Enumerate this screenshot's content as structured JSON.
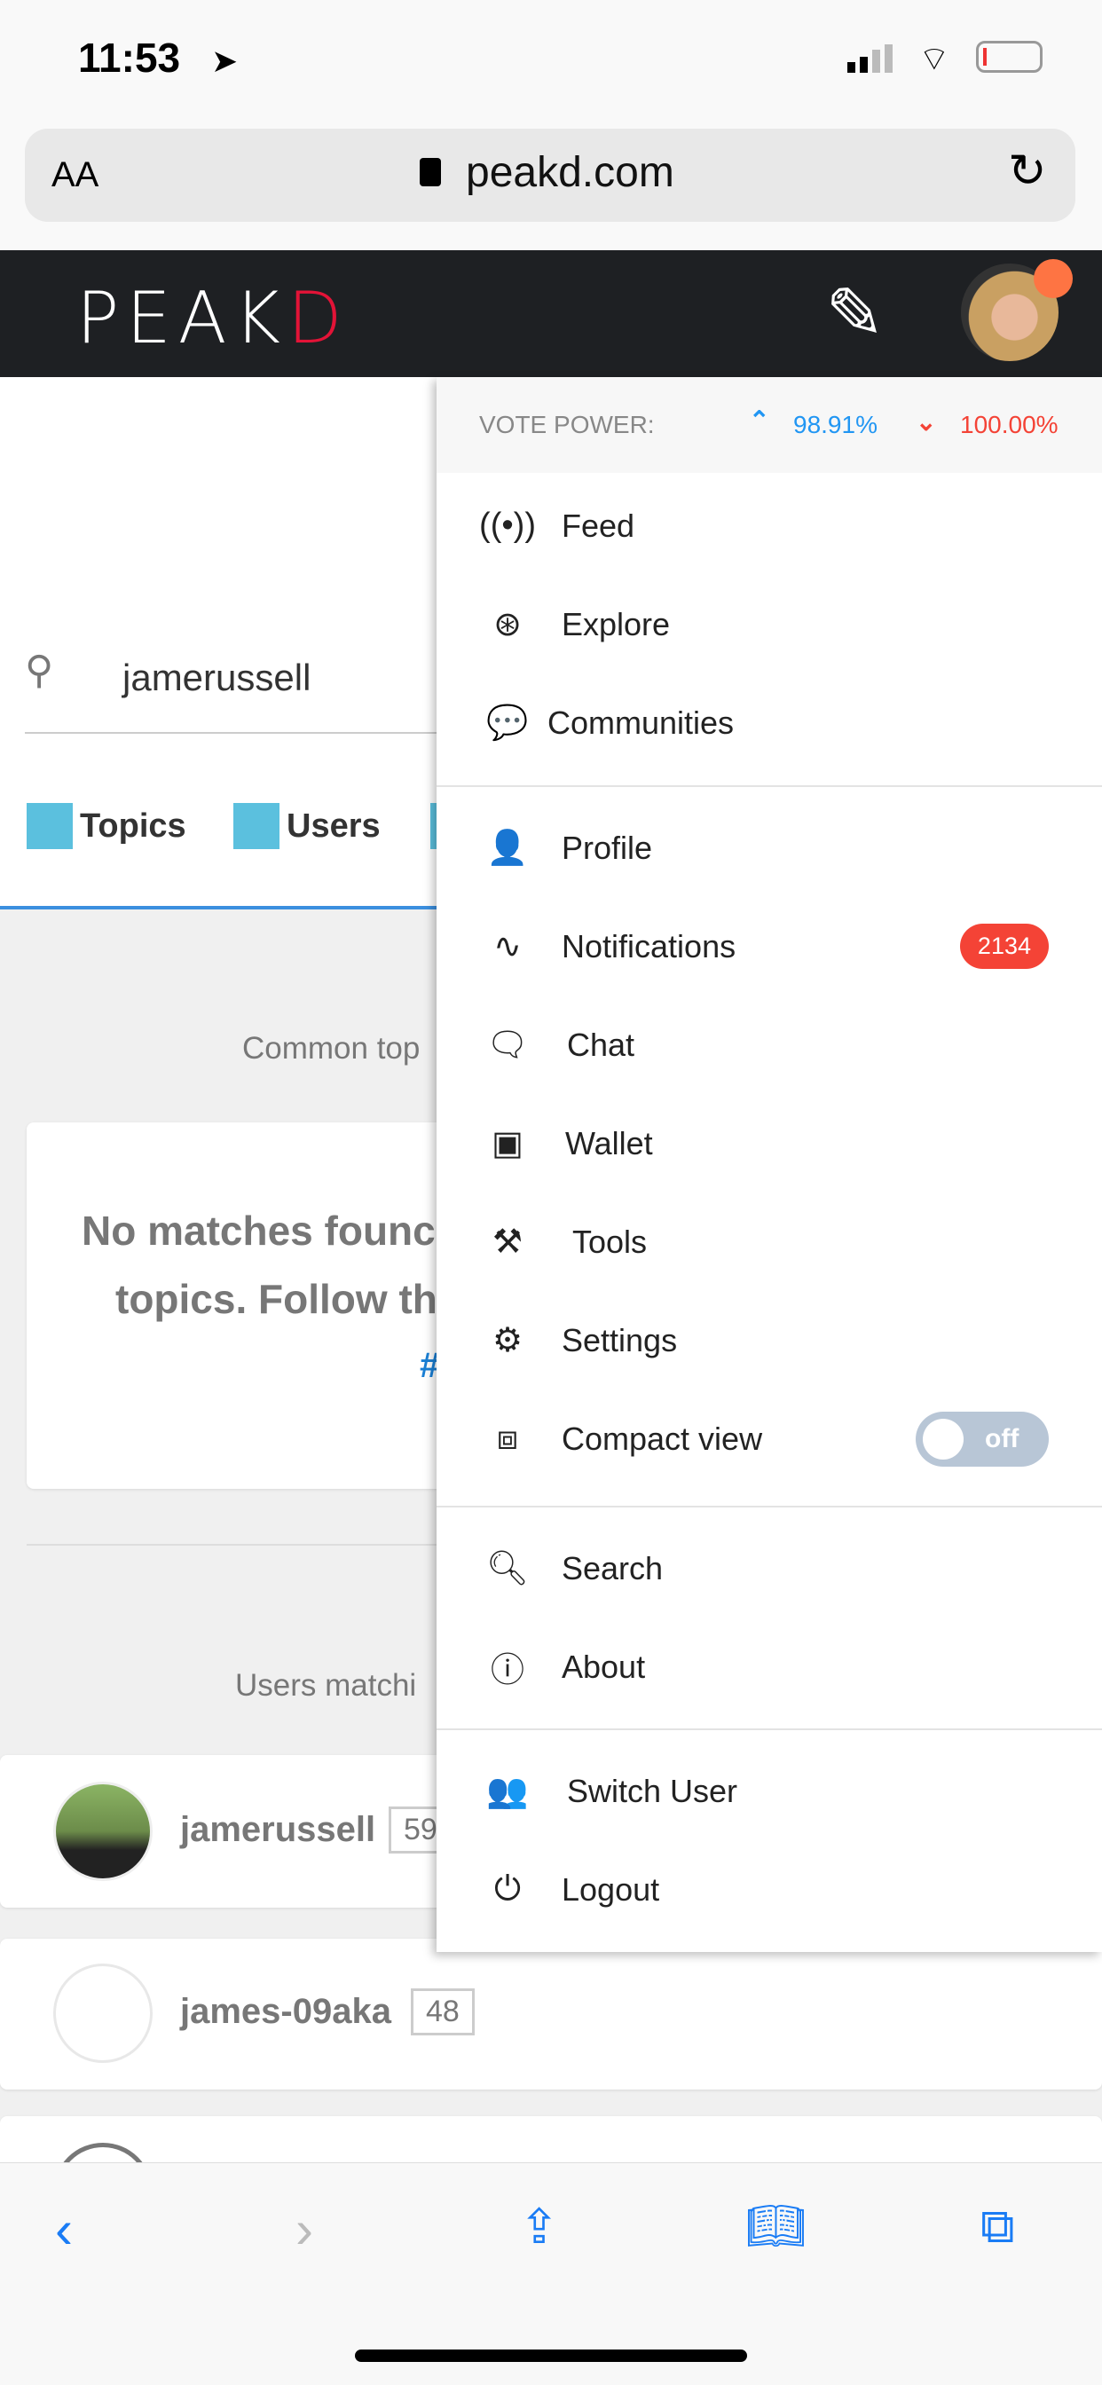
{
  "status_bar": {
    "time": "11:53"
  },
  "browser": {
    "text_size": "AA",
    "url": "peakd.com"
  },
  "header": {
    "logo": "PEAKD"
  },
  "search": {
    "value": "jamerussell"
  },
  "tabs": [
    {
      "label": "Topics"
    },
    {
      "label": "Users"
    }
  ],
  "content": {
    "common_topics": "Common top",
    "no_match_line1": "No matches founc",
    "no_match_line2": "topics. Follow th",
    "no_match_link": "#",
    "users_heading": "Users matchi",
    "users": [
      {
        "name": "jamerussell",
        "rep": "59"
      },
      {
        "name": "james-09aka",
        "rep": "48"
      }
    ]
  },
  "menu": {
    "vote_power_label": "VOTE POWER:",
    "upvote": "98.91%",
    "downvote": "100.00%",
    "items": [
      {
        "label": "Feed"
      },
      {
        "label": "Explore"
      },
      {
        "label": "Communities"
      },
      {
        "label": "Profile"
      },
      {
        "label": "Notifications",
        "badge": "2134"
      },
      {
        "label": "Chat"
      },
      {
        "label": "Wallet"
      },
      {
        "label": "Tools"
      },
      {
        "label": "Settings"
      },
      {
        "label": "Compact view",
        "toggle": "off"
      },
      {
        "label": "Search"
      },
      {
        "label": "About"
      },
      {
        "label": "Switch User"
      },
      {
        "label": "Logout"
      }
    ]
  },
  "colors": {
    "header": "#1e2023",
    "brand_red": "#e31337",
    "up": "#2196f3",
    "down": "#f44336",
    "badge": "#f44336"
  }
}
